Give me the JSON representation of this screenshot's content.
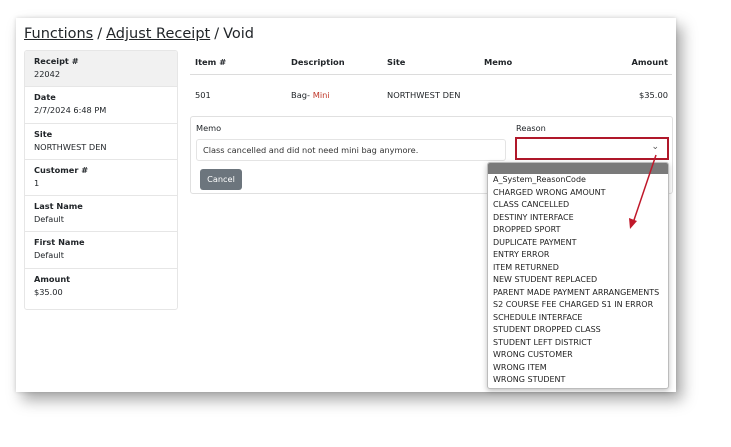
{
  "breadcrumb": {
    "functions": "Functions",
    "adjust_receipt": "Adjust Receipt",
    "void": "Void",
    "separator": "/"
  },
  "sidebar": [
    {
      "label": "Receipt #",
      "value": "22042"
    },
    {
      "label": "Date",
      "value": "2/7/2024 6:48 PM"
    },
    {
      "label": "Site",
      "value": "NORTHWEST DEN"
    },
    {
      "label": "Customer #",
      "value": "1"
    },
    {
      "label": "Last Name",
      "value": "Default"
    },
    {
      "label": "First Name",
      "value": "Default"
    },
    {
      "label": "Amount",
      "value": "$35.00"
    }
  ],
  "table": {
    "headers": {
      "item": "Item #",
      "description": "Description",
      "site": "Site",
      "memo": "Memo",
      "amount": "Amount"
    },
    "row": {
      "item": "501",
      "description_prefix": "Bag- ",
      "description_highlight": "Mini",
      "site": "NORTHWEST DEN",
      "memo": "",
      "amount": "$35.00"
    }
  },
  "void_form": {
    "memo_label": "Memo",
    "memo_value": "Class cancelled and did not need mini bag anymore.",
    "reason_label": "Reason",
    "reason_value": "",
    "chevron_glyph": "⌄",
    "cancel_label": "Cancel"
  },
  "reason_options": [
    "A_System_ReasonCode",
    "CHARGED WRONG AMOUNT",
    "CLASS CANCELLED",
    "DESTINY INTERFACE",
    "DROPPED SPORT",
    "DUPLICATE PAYMENT",
    "ENTRY ERROR",
    "ITEM RETURNED",
    "NEW STUDENT REPLACED",
    "PARENT MADE PAYMENT ARRANGEMENTS",
    "S2 COURSE FEE CHARGED S1 IN ERROR",
    "SCHEDULE INTERFACE",
    "STUDENT DROPPED CLASS",
    "STUDENT LEFT DISTRICT",
    "WRONG CUSTOMER",
    "WRONG ITEM",
    "WRONG STUDENT"
  ],
  "colors": {
    "highlight_border": "#b0182a",
    "cancel_button": "#6c757d",
    "annotation_arrow": "#c0182a"
  }
}
